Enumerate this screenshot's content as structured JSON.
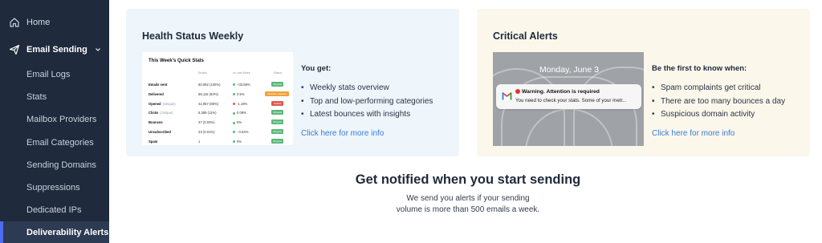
{
  "sidebar": {
    "items": [
      {
        "label": "Home",
        "icon": "home-icon"
      },
      {
        "label": "Email Sending",
        "icon": "paper-plane-icon"
      },
      {
        "label": "Email Logs"
      },
      {
        "label": "Stats"
      },
      {
        "label": "Mailbox Providers"
      },
      {
        "label": "Email Categories"
      },
      {
        "label": "Sending Domains"
      },
      {
        "label": "Suppressions"
      },
      {
        "label": "Dedicated IPs"
      },
      {
        "label": "Deliverability Alerts"
      }
    ],
    "active": "Deliverability Alerts"
  },
  "health": {
    "title": "Health Status Weekly",
    "preview": {
      "title": "This Week's Quick Stats",
      "headers": [
        "Emails",
        "vs Last Week",
        "Status"
      ],
      "rows": [
        {
          "name": "Emails sent",
          "muted": "",
          "value": "60,092 (100%)",
          "change": "+33.86%",
          "badge": "All good",
          "badge_color": "#5cb87a",
          "dot": "#5cb87a"
        },
        {
          "name": "Delivered",
          "muted": "",
          "value": "56,115 (93%)",
          "change": "0.5%",
          "badge": "Attention required",
          "badge_color": "#f0a23a",
          "dot": "#5cb87a"
        },
        {
          "name": "Opened",
          "muted": "(Unique)",
          "value": "41,957 (80%)",
          "change": "-1.19%",
          "badge": "Critical",
          "badge_color": "#e05a4f",
          "dot": "#e05a4f"
        },
        {
          "name": "Clicks",
          "muted": "(Unique)",
          "value": "6,389 (11%)",
          "change": "0.09%",
          "badge": "All good",
          "badge_color": "#5cb87a",
          "dot": "#5cb87a"
        },
        {
          "name": "Bounces",
          "muted": "",
          "value": "37 (0.03%)",
          "change": "0%",
          "badge": "All good",
          "badge_color": "#5cb87a",
          "dot": "#5cb87a"
        },
        {
          "name": "Unsubscribed",
          "muted": "",
          "value": "23 (0.01%)",
          "change": "- 0.04%",
          "badge": "All good",
          "badge_color": "#5cb87a",
          "dot": "#5cb87a"
        },
        {
          "name": "Spam",
          "muted": "",
          "value": "1",
          "change": "0%",
          "badge": "All good",
          "badge_color": "#5cb87a",
          "dot": "#5cb87a"
        }
      ]
    },
    "list_heading": "You get:",
    "bullets": [
      "Weekly stats overview",
      "Top and low-performing categories",
      "Latest bounces with insights"
    ],
    "link": "Click here for more info"
  },
  "alerts": {
    "title": "Critical Alerts",
    "phone_date": "Monday, June 3",
    "notification_title": "Warning. Attention is required",
    "notification_body": "You need to check your stats. Some of your metr...",
    "list_heading": "Be the first to know when:",
    "bullets": [
      "Spam complaints get critical",
      "There are too many bounces a day",
      "Suspicious domain activity"
    ],
    "link": "Click here for more info"
  },
  "notify": {
    "title": "Get notified when you start sending",
    "line1": "We send you alerts if your sending",
    "line2": "volume is more than 500 emails a week."
  },
  "colors": {
    "sidebar": "#1f2a3c",
    "accent": "#4f6bf0",
    "link": "#3b7dd8"
  }
}
